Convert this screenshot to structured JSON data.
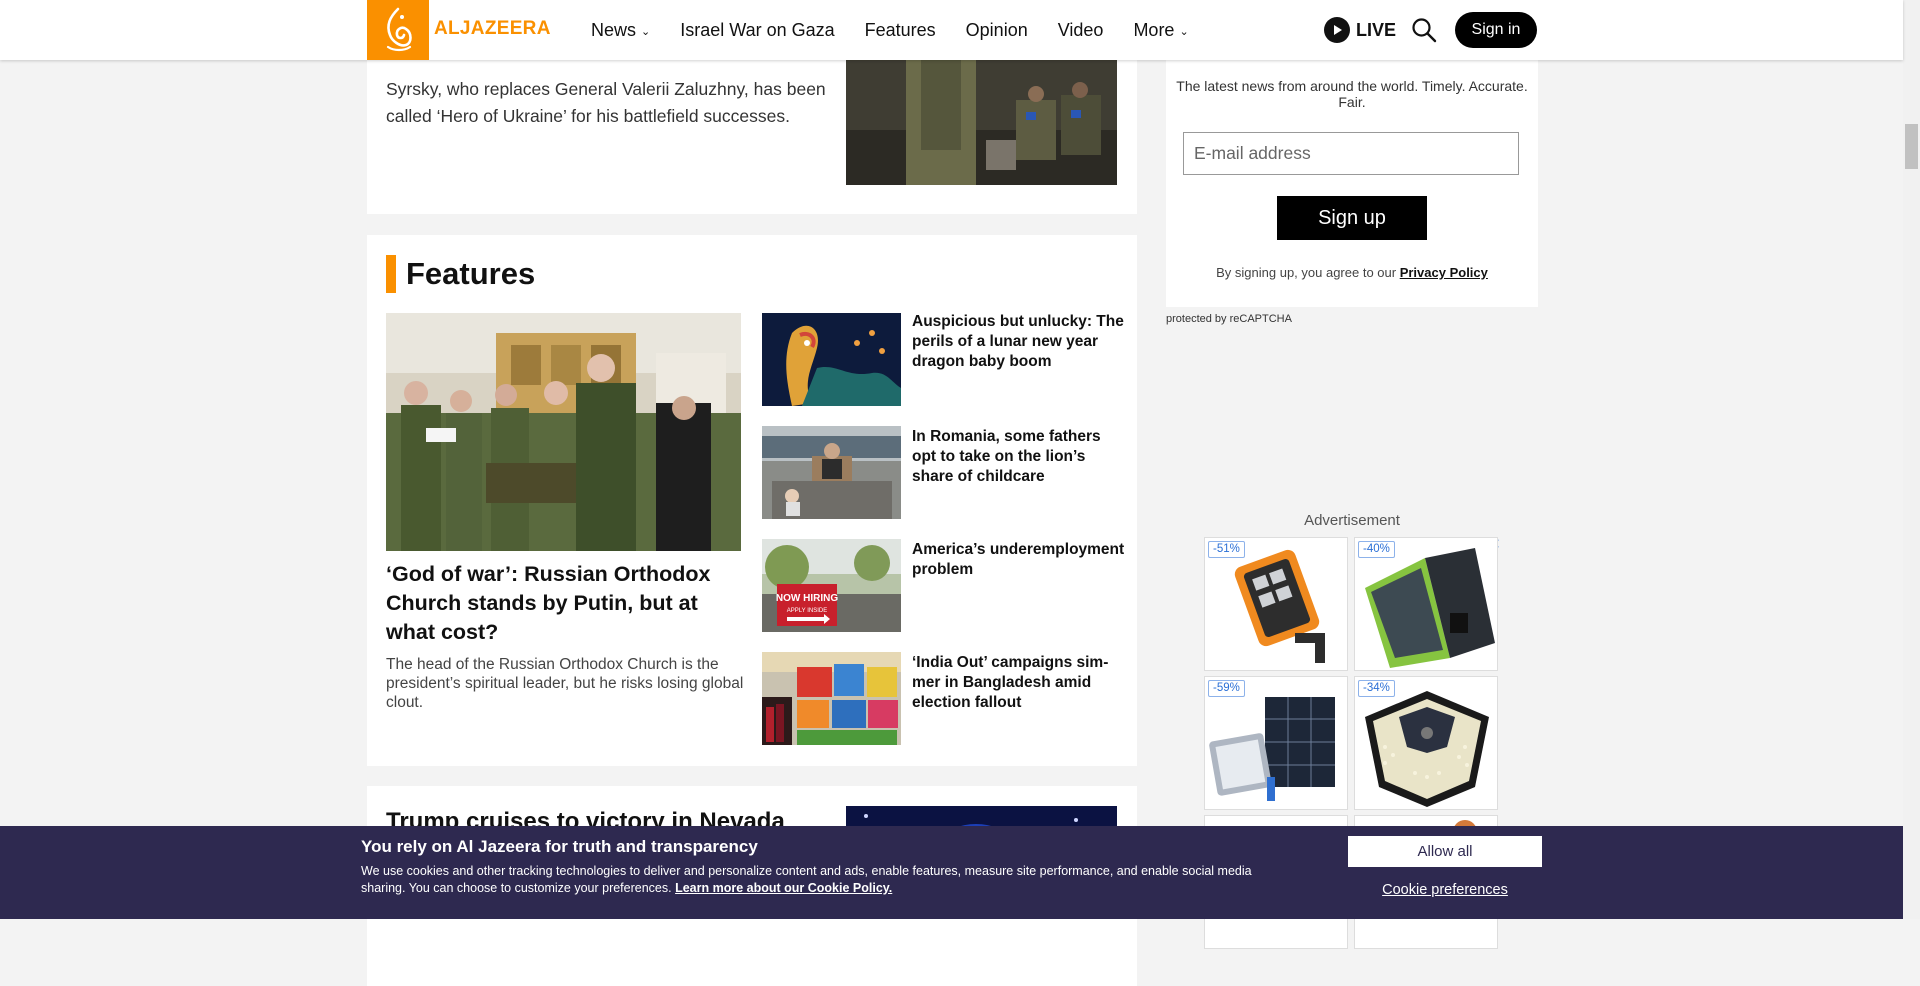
{
  "header": {
    "logo_text": "ALJAZEERA",
    "nav": [
      {
        "label": "News",
        "has_dropdown": true
      },
      {
        "label": "Israel War on Gaza",
        "has_dropdown": false
      },
      {
        "label": "Features",
        "has_dropdown": false
      },
      {
        "label": "Opinion",
        "has_dropdown": false
      },
      {
        "label": "Video",
        "has_dropdown": false
      },
      {
        "label": "More",
        "has_dropdown": true
      }
    ],
    "live_label": "LIVE",
    "signin_label": "Sign in"
  },
  "lead_story": {
    "description": "Syrsky, who replaces General Valerii Zaluzhny, has been called ‘Hero of Ukraine’ for his battlefield successes."
  },
  "features": {
    "section_title": "Features",
    "main": {
      "title": "‘God of war’: Russian Orthodox Church stands by Putin, but at what cost?",
      "description": "The head of the Russian Orthodox Church is the president’s spiritual leader, but he risks losing glob­al clout."
    },
    "items": [
      {
        "title": "Auspicious but unlucky: The perils of a lunar new year dragon baby boom"
      },
      {
        "title": "In Romania, some fathers opt to take on the lion’s share of childcare"
      },
      {
        "title": "America’s underemployment problem"
      },
      {
        "title": "‘India Out’ campaigns sim­mer in Bangladesh amid election fallout"
      }
    ]
  },
  "next_story": {
    "title": "Trump cruises to victory in Nevada"
  },
  "newsletter": {
    "tagline": "The latest news from around the world. Timely. Accurate. Fair.",
    "email_placeholder": "E-mail address",
    "signup_label": "Sign up",
    "agree_text": "By signing up, you agree to our",
    "privacy_link": "Privacy Policy",
    "recaptcha_prefix": "protected by",
    "recaptcha_brand": "reCAPTCHA"
  },
  "ad": {
    "label": "Advertisement",
    "badges": [
      "-51%",
      "-40%",
      "-59%",
      "-34%"
    ]
  },
  "cookie": {
    "title": "You rely on Al Jazeera for truth and transparency",
    "text": "We use cookies and other tracking technologies to deliver and personalize content and ads, enable features, measure site performance, and enable social media sharing. You can choose to customize your preferences.",
    "link": "Learn more about our Cookie Policy.",
    "allow_label": "Allow all",
    "prefs_label": "Cookie preferences"
  },
  "colors": {
    "brand_orange": "#fa9000",
    "cookie_bg": "#2e2950"
  },
  "icons": [
    "aljazeera-logo-icon",
    "chevron-down-icon",
    "play-icon",
    "search-icon",
    "info-icon",
    "close-icon"
  ]
}
